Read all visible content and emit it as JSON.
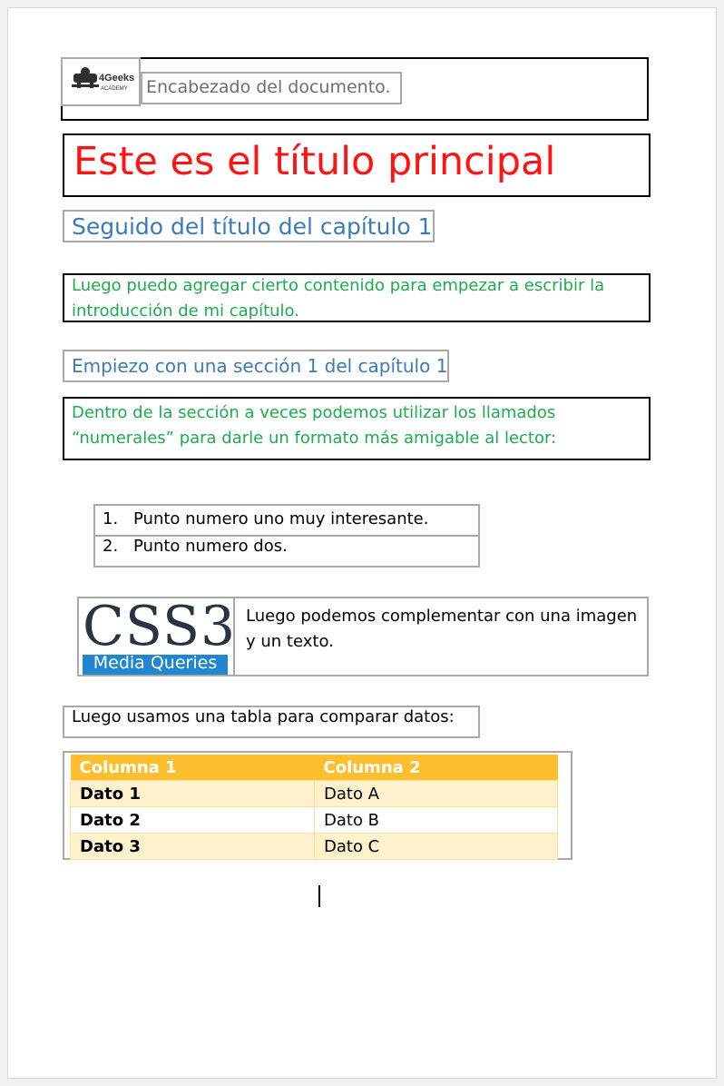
{
  "header": {
    "logo_name": "4Geeks",
    "logo_sub": "ACADEMY",
    "text": "Encabezado del documento."
  },
  "title": "Este es el título principal",
  "chapter_title": "Seguido del título del capítulo 1",
  "intro": {
    "line1": "Luego puedo agregar cierto contenido para empezar a escribir la",
    "line2": "introducción de mi capítulo."
  },
  "section_title": "Empiezo con una sección 1 del capítulo 1",
  "section_text": {
    "line1": "Dentro de la sección a veces podemos utilizar los llamados",
    "line2": "“numerales” para darle un formato más amigable al lector:"
  },
  "list": [
    {
      "num": "1.",
      "text": "Punto numero uno muy interesante."
    },
    {
      "num": "2.",
      "text": "Punto numero dos."
    }
  ],
  "media": {
    "image_word": "CSS3",
    "image_sub": "Media Queries",
    "line1": "Luego podemos complementar con una imagen",
    "line2": "y un texto."
  },
  "table_intro": "Luego usamos una tabla para comparar datos:",
  "table": {
    "headers": [
      "Columna 1",
      "Columna 2"
    ],
    "rows": [
      [
        "Dato 1",
        "Dato A"
      ],
      [
        "Dato 2",
        "Dato B"
      ],
      [
        "Dato 3",
        "Dato C"
      ]
    ]
  },
  "colors": {
    "title": "#ff1313",
    "heading_blue": "#3d7ab8",
    "green_text": "#1cac4d",
    "table_header": "#fdbf2d",
    "table_band": "#fef1cb"
  }
}
